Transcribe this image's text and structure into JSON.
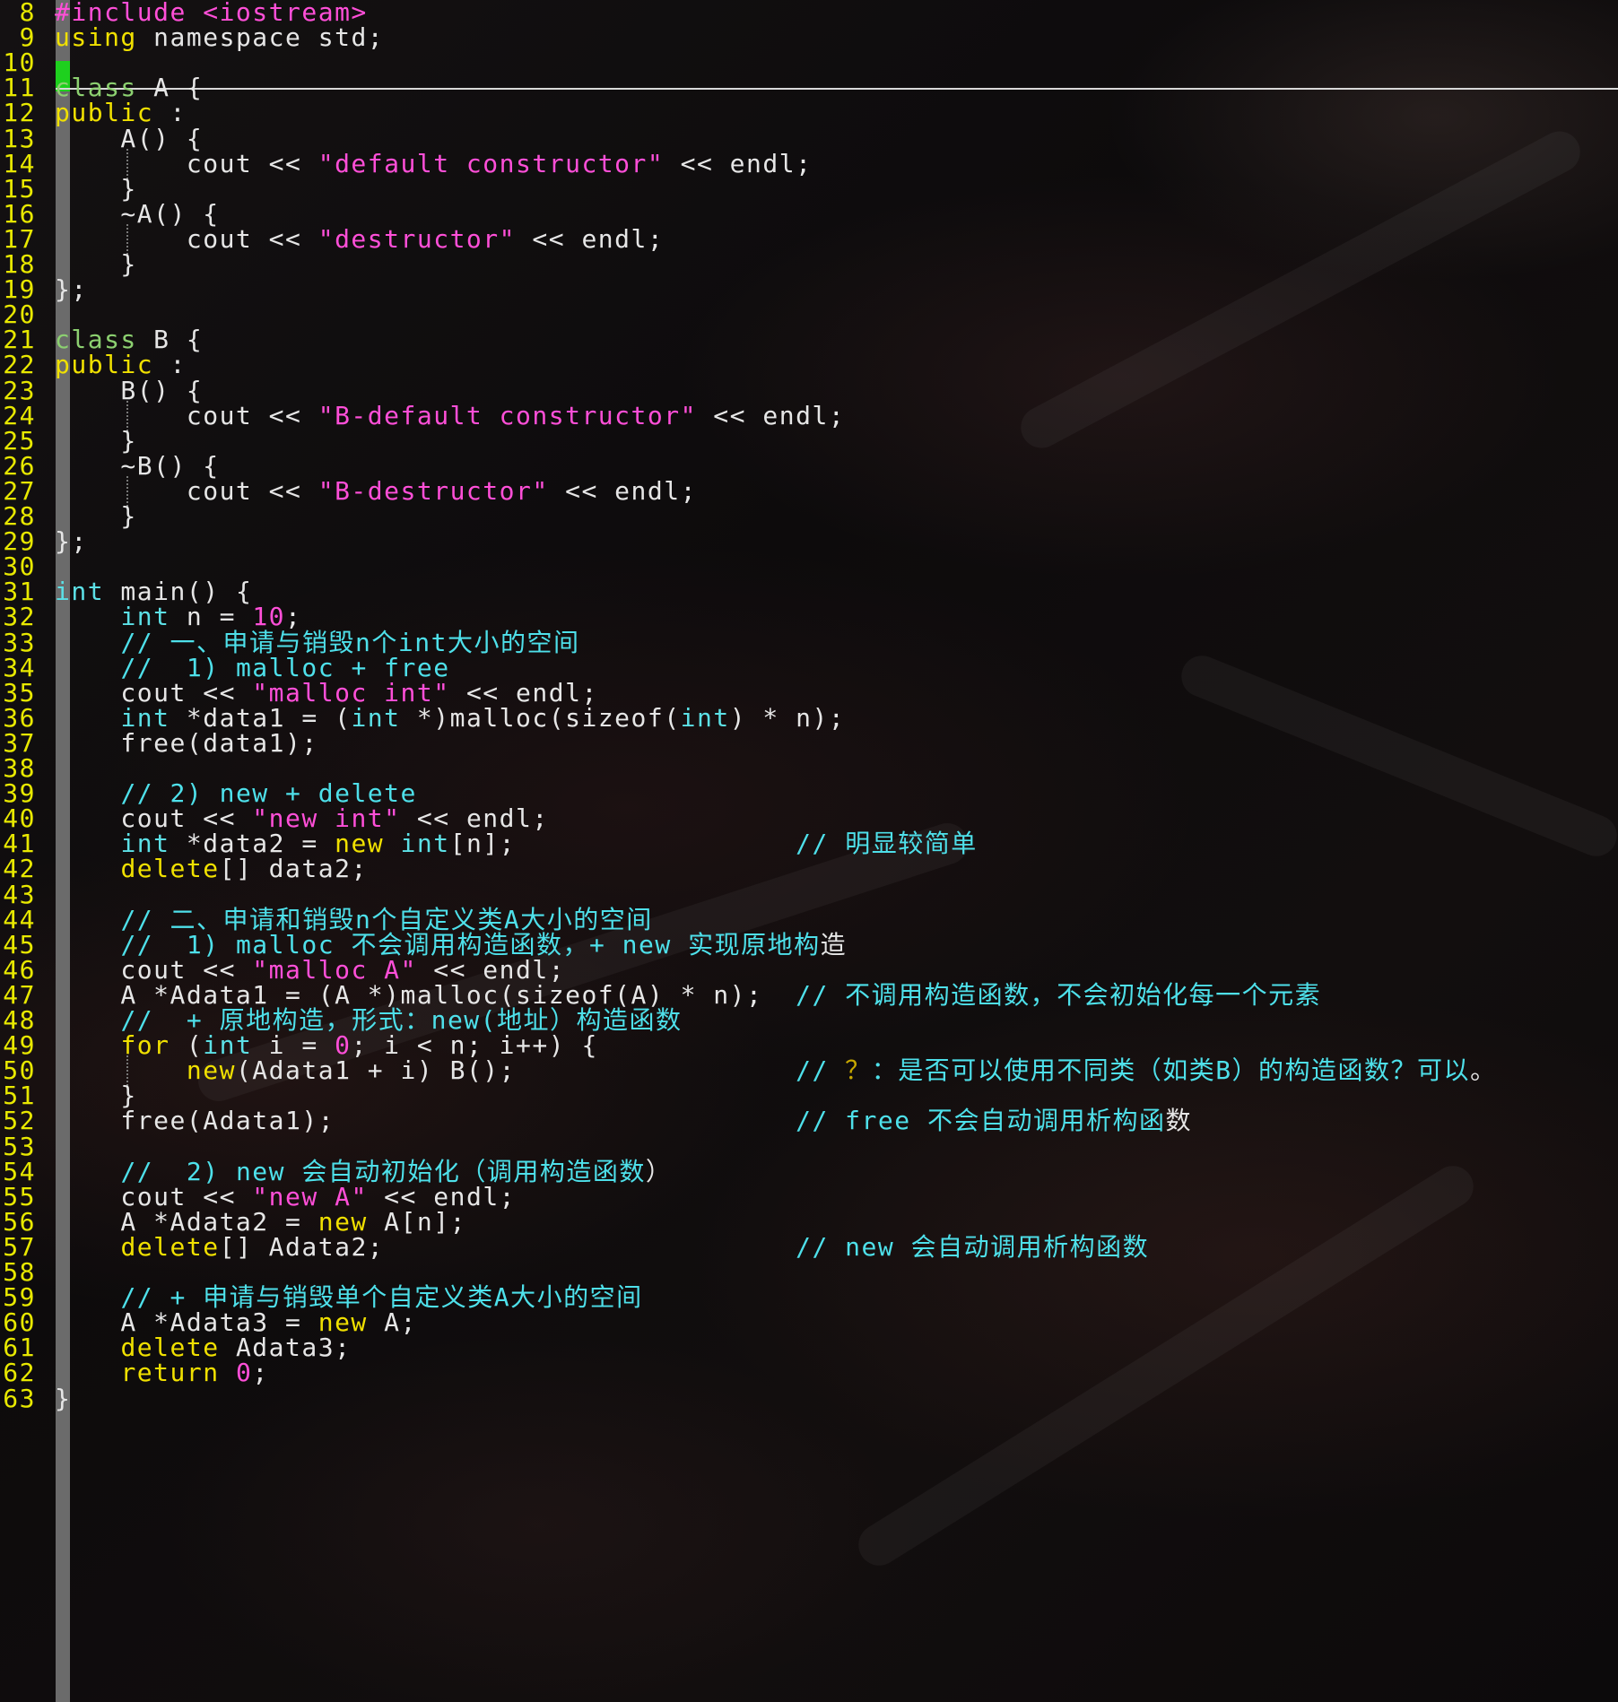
{
  "editor": {
    "lines": [
      {
        "n": "8",
        "text": "#include <iostream>",
        "hl": [
          [
            0,
            8,
            "pp"
          ],
          [
            9,
            19,
            "st"
          ]
        ]
      },
      {
        "n": "9",
        "text": "using namespace std;",
        "hl": [
          [
            0,
            5,
            "kw"
          ]
        ]
      },
      {
        "n": "10",
        "text": "",
        "hl": []
      },
      {
        "n": "11",
        "text": "class A {",
        "hl": [
          [
            0,
            5,
            "cl"
          ]
        ]
      },
      {
        "n": "12",
        "text": "public :",
        "hl": [
          [
            0,
            6,
            "kw"
          ]
        ]
      },
      {
        "n": "13",
        "text": "    A() {",
        "hl": []
      },
      {
        "n": "14",
        "text": "        cout << \"default constructor\" << endl;",
        "hl": [
          [
            16,
            37,
            "st"
          ]
        ],
        "guide": 1
      },
      {
        "n": "15",
        "text": "    }",
        "hl": []
      },
      {
        "n": "16",
        "text": "    ~A() {",
        "hl": []
      },
      {
        "n": "17",
        "text": "        cout << \"destructor\" << endl;",
        "hl": [
          [
            16,
            28,
            "st"
          ]
        ],
        "guide": 1
      },
      {
        "n": "18",
        "text": "    }",
        "hl": []
      },
      {
        "n": "19",
        "text": "};",
        "hl": []
      },
      {
        "n": "20",
        "text": "",
        "hl": []
      },
      {
        "n": "21",
        "text": "class B {",
        "hl": [
          [
            0,
            5,
            "cl"
          ]
        ]
      },
      {
        "n": "22",
        "text": "public :",
        "hl": [
          [
            0,
            6,
            "kw"
          ]
        ]
      },
      {
        "n": "23",
        "text": "    B() {",
        "hl": []
      },
      {
        "n": "24",
        "text": "        cout << \"B-default constructor\" << endl;",
        "hl": [
          [
            16,
            39,
            "st"
          ]
        ],
        "guide": 1
      },
      {
        "n": "25",
        "text": "    }",
        "hl": []
      },
      {
        "n": "26",
        "text": "    ~B() {",
        "hl": []
      },
      {
        "n": "27",
        "text": "        cout << \"B-destructor\" << endl;",
        "hl": [
          [
            16,
            30,
            "st"
          ]
        ],
        "guide": 1
      },
      {
        "n": "28",
        "text": "    }",
        "hl": []
      },
      {
        "n": "29",
        "text": "};",
        "hl": []
      },
      {
        "n": "30",
        "text": "",
        "hl": []
      },
      {
        "n": "31",
        "text": "int main() {",
        "hl": [
          [
            0,
            3,
            "ty"
          ]
        ]
      },
      {
        "n": "32",
        "text": "    int n = 10;",
        "hl": [
          [
            4,
            7,
            "ty"
          ],
          [
            12,
            14,
            "nm"
          ]
        ]
      },
      {
        "n": "33",
        "text": "    // 一、申请与销毁n个int大小的空间",
        "hl": [
          [
            4,
            24,
            "cm"
          ]
        ]
      },
      {
        "n": "34",
        "text": "    //  1) malloc + free",
        "hl": [
          [
            4,
            24,
            "cm"
          ]
        ]
      },
      {
        "n": "35",
        "text": "    cout << \"malloc int\" << endl;",
        "hl": [
          [
            12,
            24,
            "st"
          ]
        ]
      },
      {
        "n": "36",
        "text": "    int *data1 = (int *)malloc(sizeof(int) * n);",
        "hl": [
          [
            4,
            7,
            "ty"
          ],
          [
            18,
            21,
            "ty"
          ],
          [
            38,
            41,
            "ty"
          ]
        ]
      },
      {
        "n": "37",
        "text": "    free(data1);",
        "hl": []
      },
      {
        "n": "38",
        "text": "",
        "hl": []
      },
      {
        "n": "39",
        "text": "    // 2) new + delete",
        "hl": [
          [
            4,
            22,
            "cm"
          ]
        ]
      },
      {
        "n": "40",
        "text": "    cout << \"new int\" << endl;",
        "hl": [
          [
            12,
            21,
            "st"
          ]
        ]
      },
      {
        "n": "41",
        "text": "    int *data2 = new int[n];                 // 明显较简单",
        "hl": [
          [
            4,
            7,
            "ty"
          ],
          [
            17,
            20,
            "kw"
          ],
          [
            21,
            24,
            "ty"
          ],
          [
            45,
            53,
            "cm"
          ]
        ]
      },
      {
        "n": "42",
        "text": "    delete[] data2;",
        "hl": [
          [
            4,
            10,
            "kw"
          ]
        ]
      },
      {
        "n": "43",
        "text": "",
        "hl": []
      },
      {
        "n": "44",
        "text": "    // 二、申请和销毁n个自定义类A大小的空间",
        "hl": [
          [
            4,
            27,
            "cm"
          ]
        ]
      },
      {
        "n": "45",
        "text": "    //  1) malloc 不会调用构造函数，+ new 实现原地构造",
        "hl": [
          [
            4,
            38,
            "cm"
          ]
        ]
      },
      {
        "n": "46",
        "text": "    cout << \"malloc A\" << endl;",
        "hl": [
          [
            12,
            22,
            "st"
          ]
        ]
      },
      {
        "n": "47",
        "text": "    A *Adata1 = (A *)malloc(sizeof(A) * n);  // 不调用构造函数，不会初始化每一个元素",
        "hl": [
          [
            45,
            66,
            "cm"
          ]
        ]
      },
      {
        "n": "48",
        "text": "    //  + 原地构造，形式：new(地址）构造函数",
        "hl": [
          [
            4,
            29,
            "cm"
          ]
        ]
      },
      {
        "n": "49",
        "text": "    for (int i = 0; i < n; i++) {",
        "hl": [
          [
            4,
            7,
            "kw"
          ],
          [
            9,
            12,
            "ty"
          ],
          [
            17,
            18,
            "nm"
          ]
        ]
      },
      {
        "n": "50",
        "text": "        new(Adata1 + i) B();                 // ？：是否可以使用不同类（如类B）的构造函数？可以。",
        "hl": [
          [
            8,
            11,
            "kw"
          ],
          [
            45,
            48,
            "cm"
          ],
          [
            48,
            49,
            "warn"
          ],
          [
            49,
            72,
            "cm"
          ]
        ],
        "guide": 1
      },
      {
        "n": "51",
        "text": "    }",
        "hl": []
      },
      {
        "n": "52",
        "text": "    free(Adata1);                            // free 不会自动调用析构函数",
        "hl": [
          [
            45,
            62,
            "cm"
          ]
        ]
      },
      {
        "n": "53",
        "text": "",
        "hl": []
      },
      {
        "n": "54",
        "text": "    //  2) new 会自动初始化（调用构造函数）",
        "hl": [
          [
            4,
            28,
            "cm"
          ]
        ]
      },
      {
        "n": "55",
        "text": "    cout << \"new A\" << endl;",
        "hl": [
          [
            12,
            19,
            "st"
          ]
        ]
      },
      {
        "n": "56",
        "text": "    A *Adata2 = new A[n];",
        "hl": [
          [
            16,
            19,
            "kw"
          ]
        ]
      },
      {
        "n": "57",
        "text": "    delete[] Adata2;                         // new 会自动调用析构函数",
        "hl": [
          [
            4,
            10,
            "kw"
          ],
          [
            45,
            61,
            "cm"
          ]
        ]
      },
      {
        "n": "58",
        "text": "",
        "hl": []
      },
      {
        "n": "59",
        "text": "    // + 申请与销毁单个自定义类A大小的空间",
        "hl": [
          [
            4,
            27,
            "cm"
          ]
        ]
      },
      {
        "n": "60",
        "text": "    A *Adata3 = new A;",
        "hl": [
          [
            16,
            19,
            "kw"
          ]
        ]
      },
      {
        "n": "61",
        "text": "    delete Adata3;",
        "hl": [
          [
            4,
            10,
            "kw"
          ]
        ]
      },
      {
        "n": "62",
        "text": "    return 0;",
        "hl": [
          [
            4,
            10,
            "kw"
          ],
          [
            11,
            12,
            "nm"
          ]
        ]
      },
      {
        "n": "63",
        "text": "}",
        "hl": []
      }
    ]
  }
}
